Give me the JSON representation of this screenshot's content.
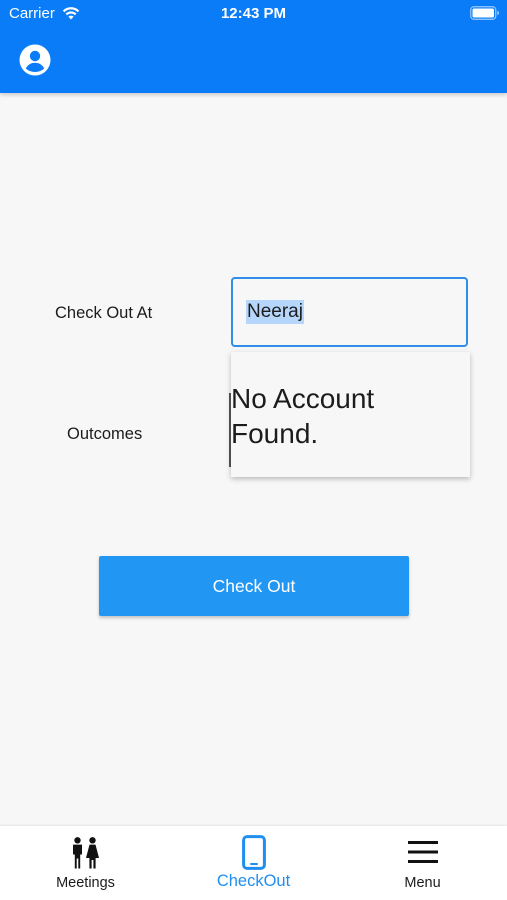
{
  "status_bar": {
    "carrier": "Carrier",
    "time": "12:43 PM",
    "wifi_icon": "wifi-icon",
    "battery_icon": "battery-icon"
  },
  "app_bar": {
    "color": "#0a7cf7",
    "account_icon": "account-circle-icon"
  },
  "form": {
    "checkout_at_label": "Check Out At",
    "checkout_at_value": "Neeraj",
    "outcomes_label": "Outcomes",
    "suggestion_message": "No Account Found.",
    "checkout_button_label": "Check Out",
    "button_color": "#2196f3"
  },
  "bottom_nav": {
    "active_color": "#1f8ef1",
    "items": [
      {
        "label": "Meetings",
        "icon": "people-icon",
        "active": false
      },
      {
        "label": "CheckOut",
        "icon": "phone-icon",
        "active": true
      },
      {
        "label": "Menu",
        "icon": "hamburger-menu-icon",
        "active": false
      }
    ]
  }
}
